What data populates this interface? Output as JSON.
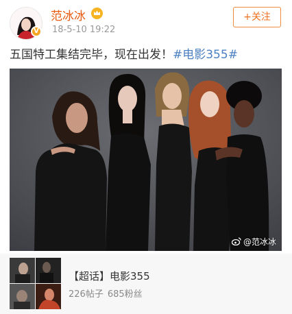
{
  "user": {
    "name": "范冰冰",
    "time": "18-5-10 19:22",
    "follow_label": "+关注"
  },
  "post": {
    "text": "五国特工集结完毕，现在出发！",
    "topic": "#电影355#"
  },
  "photo": {
    "watermark": "@范冰冰"
  },
  "card": {
    "title": "【超话】电影355",
    "posts": "226帖子",
    "fans": "685粉丝"
  },
  "colors": {
    "accent": "#e85a0d",
    "topic_link": "#4a7fc1",
    "verified": "#f5a623"
  }
}
